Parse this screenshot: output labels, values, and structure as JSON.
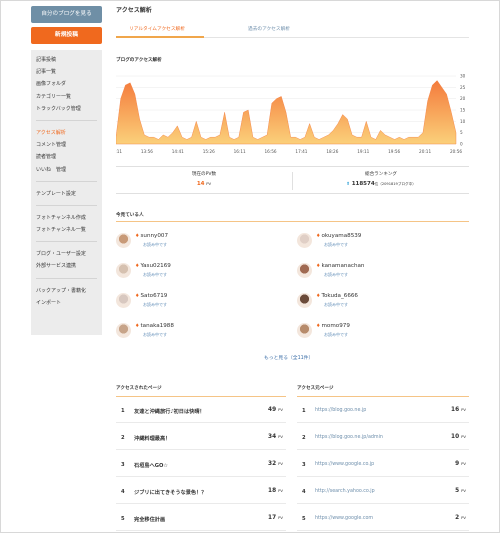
{
  "sidebar": {
    "myblog_button": "自分のブログを見る",
    "newpost_button": "新規投稿",
    "groups": [
      [
        "記事投稿",
        "記事一覧",
        "画像フォルダ",
        "カテゴリー一覧",
        "トラックバック管理"
      ],
      [
        "アクセス解析",
        "コメント管理",
        "読者管理",
        "いいね　管理"
      ],
      [
        "テンプレート設定"
      ],
      [
        "フォトチャンネル作成",
        "フォトチャンネル一覧"
      ],
      [
        "ブログ・ユーザー設定",
        "外部サービス連携"
      ],
      [
        "バックアップ・書籍化",
        "インポート"
      ]
    ]
  },
  "main": {
    "title": "アクセス解析",
    "tabs": [
      "リアルタイムアクセス解析",
      "過去のアクセス解析"
    ],
    "chart_section_title": "ブログのアクセス解析"
  },
  "chart_data": {
    "type": "area",
    "x_ticks": [
      "13:11",
      "13:56",
      "14:41",
      "15:26",
      "16:11",
      "16:56",
      "17:41",
      "18:26",
      "19:11",
      "19:56",
      "20:11",
      "20:56"
    ],
    "y_ticks": [
      0,
      5,
      10,
      15,
      20,
      25,
      30
    ],
    "ylim": [
      0,
      30
    ],
    "color": "#f7a24a",
    "values": [
      3,
      20,
      26,
      27,
      22,
      11,
      4,
      3,
      3,
      2,
      4,
      3,
      5,
      8,
      3,
      2,
      3,
      10,
      3,
      2,
      3,
      3,
      4,
      14,
      3,
      2,
      3,
      14,
      15,
      3,
      2,
      3,
      4,
      18,
      20,
      21,
      14,
      3,
      3,
      2,
      3,
      9,
      3,
      2,
      3,
      4,
      6,
      9,
      13,
      11,
      4,
      3,
      3,
      10,
      3,
      2,
      6,
      4,
      3,
      2,
      3,
      2,
      3,
      3,
      3,
      5,
      19,
      26,
      28,
      25,
      22,
      14,
      5
    ]
  },
  "stats": {
    "pv_label": "現在のPV数",
    "pv_value": "14",
    "pv_unit": "PV",
    "rank_label": "総合ランキング",
    "rank_value": "118574",
    "rank_suffix": "位（2091819ブログ中）"
  },
  "visitors_title": "今見ている人",
  "visitors": [
    {
      "name": "sunny007",
      "sub": "お読み中です"
    },
    {
      "name": "okuyama8539",
      "sub": "お読み中です"
    },
    {
      "name": "Yasu02169",
      "sub": "お読み中です"
    },
    {
      "name": "kanamanachan",
      "sub": "お読み中です"
    },
    {
      "name": "Sato6719",
      "sub": "お読み中です"
    },
    {
      "name": "Tokuda_6666",
      "sub": "お読み中です"
    },
    {
      "name": "tanaka1988",
      "sub": "お読み中です"
    },
    {
      "name": "momo979",
      "sub": "お読み中です"
    }
  ],
  "more_link": "もっと見る（全11件）",
  "pages_title": "アクセスされたページ",
  "pages": [
    {
      "rank": "1",
      "title": "友達と沖縄旅行♪初日は快晴！",
      "pv": "49"
    },
    {
      "rank": "2",
      "title": "沖縄料理最高！",
      "pv": "34"
    },
    {
      "rank": "3",
      "title": "石垣島へGO☆",
      "pv": "32"
    },
    {
      "rank": "4",
      "title": "ジブリに出てきそうな景色！？",
      "pv": "18"
    },
    {
      "rank": "5",
      "title": "完全移住計画",
      "pv": "17"
    }
  ],
  "sources_title": "アクセス元ページ",
  "sources": [
    {
      "rank": "1",
      "url": "https://blog.goo.ne.jp",
      "pv": "16"
    },
    {
      "rank": "2",
      "url": "https://blog.goo.ne.jp/admin",
      "pv": "10"
    },
    {
      "rank": "3",
      "url": "https://www.google.co.jp",
      "pv": "9"
    },
    {
      "rank": "4",
      "url": "http://search.yahoo.co.jp",
      "pv": "5"
    },
    {
      "rank": "5",
      "url": "https://www.google.com",
      "pv": "2"
    }
  ],
  "pv_unit": "PV"
}
